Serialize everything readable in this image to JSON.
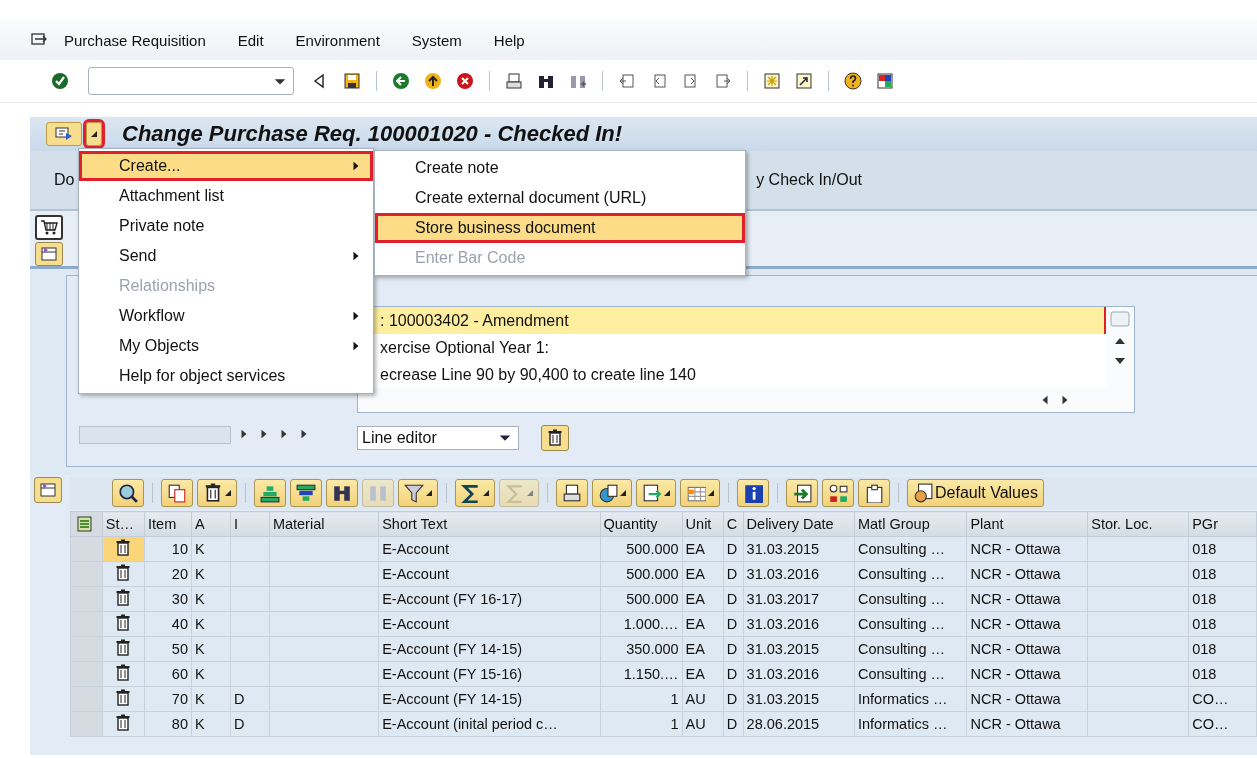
{
  "menu_bar": [
    {
      "label": "Purchase Requisition"
    },
    {
      "label": "Edit"
    },
    {
      "label": "Environment"
    },
    {
      "label": "System"
    },
    {
      "label": "Help"
    }
  ],
  "title_bar": {
    "title": "Change Purchase Req. 100001020 - Checked In!",
    "menu_button_highlighted": true
  },
  "app_toolbar": [
    "Do",
    "y Check In/Out"
  ],
  "context_menu": {
    "items": [
      {
        "label": "Create...",
        "selected": true,
        "disabled": false,
        "has_submenu": true
      },
      {
        "label": "Attachment list",
        "selected": false,
        "disabled": false,
        "has_submenu": false
      },
      {
        "label": "Private note",
        "selected": false,
        "disabled": false,
        "has_submenu": false
      },
      {
        "label": "Send",
        "selected": false,
        "disabled": false,
        "has_submenu": true
      },
      {
        "label": "Relationships",
        "selected": false,
        "disabled": true,
        "has_submenu": false
      },
      {
        "label": "Workflow",
        "selected": false,
        "disabled": false,
        "has_submenu": true
      },
      {
        "label": "My Objects",
        "selected": false,
        "disabled": false,
        "has_submenu": true
      },
      {
        "label": "Help for object services",
        "selected": false,
        "disabled": false,
        "has_submenu": false
      }
    ]
  },
  "submenu": {
    "items": [
      {
        "label": "Create note",
        "selected": false,
        "disabled": false
      },
      {
        "label": "Create external document (URL)",
        "selected": false,
        "disabled": false
      },
      {
        "label": "Store business document",
        "selected": true,
        "disabled": false
      },
      {
        "label": "Enter Bar Code",
        "selected": false,
        "disabled": true
      }
    ]
  },
  "text_editor": {
    "lines": [
      {
        "text": ": 100003402 - Amendment",
        "selected": true
      },
      {
        "text": "xercise Optional Year 1:",
        "selected": false
      },
      {
        "text": "ecrease Line 90 by 90,400 to create line 140",
        "selected": false
      }
    ],
    "mode": "Line editor"
  },
  "grid_toolbar": {
    "default_values_button": "Default Values"
  },
  "table": {
    "columns": [
      "St…",
      "Item",
      "A",
      "I",
      "Material",
      "Short Text",
      "Quantity",
      "Unit",
      "C",
      "Delivery Date",
      "Matl Group",
      "Plant",
      "Stor. Loc.",
      "PGr"
    ],
    "rows": [
      {
        "focused": true,
        "cells": [
          null,
          "10",
          "K",
          null,
          null,
          "E-Account",
          "500.000",
          "EA",
          "D",
          "31.03.2015",
          "Consulting …",
          "NCR - Ottawa",
          null,
          "018"
        ]
      },
      {
        "focused": false,
        "cells": [
          null,
          "20",
          "K",
          null,
          null,
          "E-Account",
          "500.000",
          "EA",
          "D",
          "31.03.2016",
          "Consulting …",
          "NCR - Ottawa",
          null,
          "018"
        ]
      },
      {
        "focused": false,
        "cells": [
          null,
          "30",
          "K",
          null,
          null,
          "E-Account (FY 16-17)",
          "500.000",
          "EA",
          "D",
          "31.03.2017",
          "Consulting …",
          "NCR - Ottawa",
          null,
          "018"
        ]
      },
      {
        "focused": false,
        "cells": [
          null,
          "40",
          "K",
          null,
          null,
          "E-Account",
          "1.000.…",
          "EA",
          "D",
          "31.03.2016",
          "Consulting …",
          "NCR - Ottawa",
          null,
          "018"
        ]
      },
      {
        "focused": false,
        "cells": [
          null,
          "50",
          "K",
          null,
          null,
          "E-Account (FY 14-15)",
          "350.000",
          "EA",
          "D",
          "31.03.2015",
          "Consulting …",
          "NCR - Ottawa",
          null,
          "018"
        ]
      },
      {
        "focused": false,
        "cells": [
          null,
          "60",
          "K",
          null,
          null,
          "E-Account (FY 15-16)",
          "1.150.…",
          "EA",
          "D",
          "31.03.2016",
          "Consulting …",
          "NCR - Ottawa",
          null,
          "018"
        ]
      },
      {
        "focused": false,
        "cells": [
          null,
          "70",
          "K",
          "D",
          null,
          "E-Account (FY 14-15)",
          "1",
          "AU",
          "D",
          "31.03.2015",
          "Informatics …",
          "NCR - Ottawa",
          null,
          "CO…"
        ]
      },
      {
        "focused": false,
        "cells": [
          null,
          "80",
          "K",
          "D",
          null,
          "E-Account (inital period c…",
          "1",
          "AU",
          "D",
          "28.06.2015",
          "Informatics …",
          "NCR - Ottawa",
          null,
          "CO…"
        ]
      }
    ]
  }
}
